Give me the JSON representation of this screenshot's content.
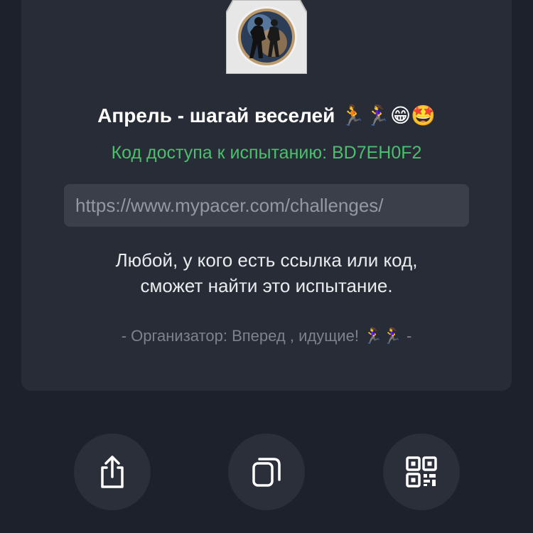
{
  "challenge": {
    "title": "Апрель - шагай веселей 🏃🏃‍♀️😁🤩",
    "access_code_line": "Код доступа к испытанию: BD7EH0F2",
    "link": "https://www.mypacer.com/challenges/",
    "description_line1": "Любой, у кого есть ссылка или код,",
    "description_line2": "сможет найти это испытание.",
    "organizer": "- Организатор: Вперед , идущие! 🏃‍♀️🏃‍♀️ -"
  },
  "actions": [
    {
      "icon": "share-icon"
    },
    {
      "icon": "copy-icon"
    },
    {
      "icon": "qr-code-icon"
    }
  ],
  "colors": {
    "background": "#1c212b",
    "card": "#272c36",
    "accent_green": "#4cbf6e",
    "field": "#3a3f49"
  }
}
